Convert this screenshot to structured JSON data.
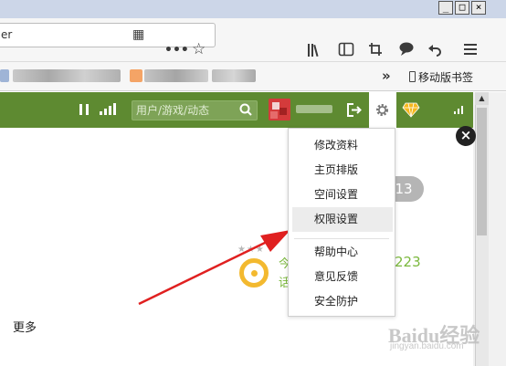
{
  "window": {
    "controls": {
      "minimize": "_",
      "maximize": "□",
      "close": "×"
    }
  },
  "browser": {
    "url_text": "er",
    "toolbar_icons": [
      "qr-code-icon",
      "more-icon",
      "bookmark-star-icon",
      "library-icon",
      "sidebar-icon",
      "crop-icon",
      "chat-icon",
      "undo-icon",
      "menu-icon"
    ],
    "bookmarks": {
      "overflow": "»",
      "mobile_bookmarks": "移动版书签"
    }
  },
  "site_header": {
    "search_placeholder": "用户/游戏/动态"
  },
  "menu": {
    "items": [
      {
        "label": "修改资料"
      },
      {
        "label": "主页排版"
      },
      {
        "label": "空间设置"
      },
      {
        "label": "权限设置",
        "highlighted": true
      },
      {
        "label": "帮助中心"
      },
      {
        "label": "意见反馈"
      },
      {
        "label": "安全防护"
      }
    ]
  },
  "content": {
    "bubble_count": "13",
    "stars": "★★★",
    "green_text_1": "今",
    "green_text_2": "话",
    "number_label": "223",
    "more_label": "更多",
    "close_label": "×"
  },
  "watermark": {
    "logo": "Baidu经验",
    "url": "jingyan.baidu.com"
  },
  "colors": {
    "header_green": "#5e8a31",
    "arrow_red": "#e02020",
    "accent_yellow": "#f3b92f",
    "text_green": "#7bb83d"
  }
}
